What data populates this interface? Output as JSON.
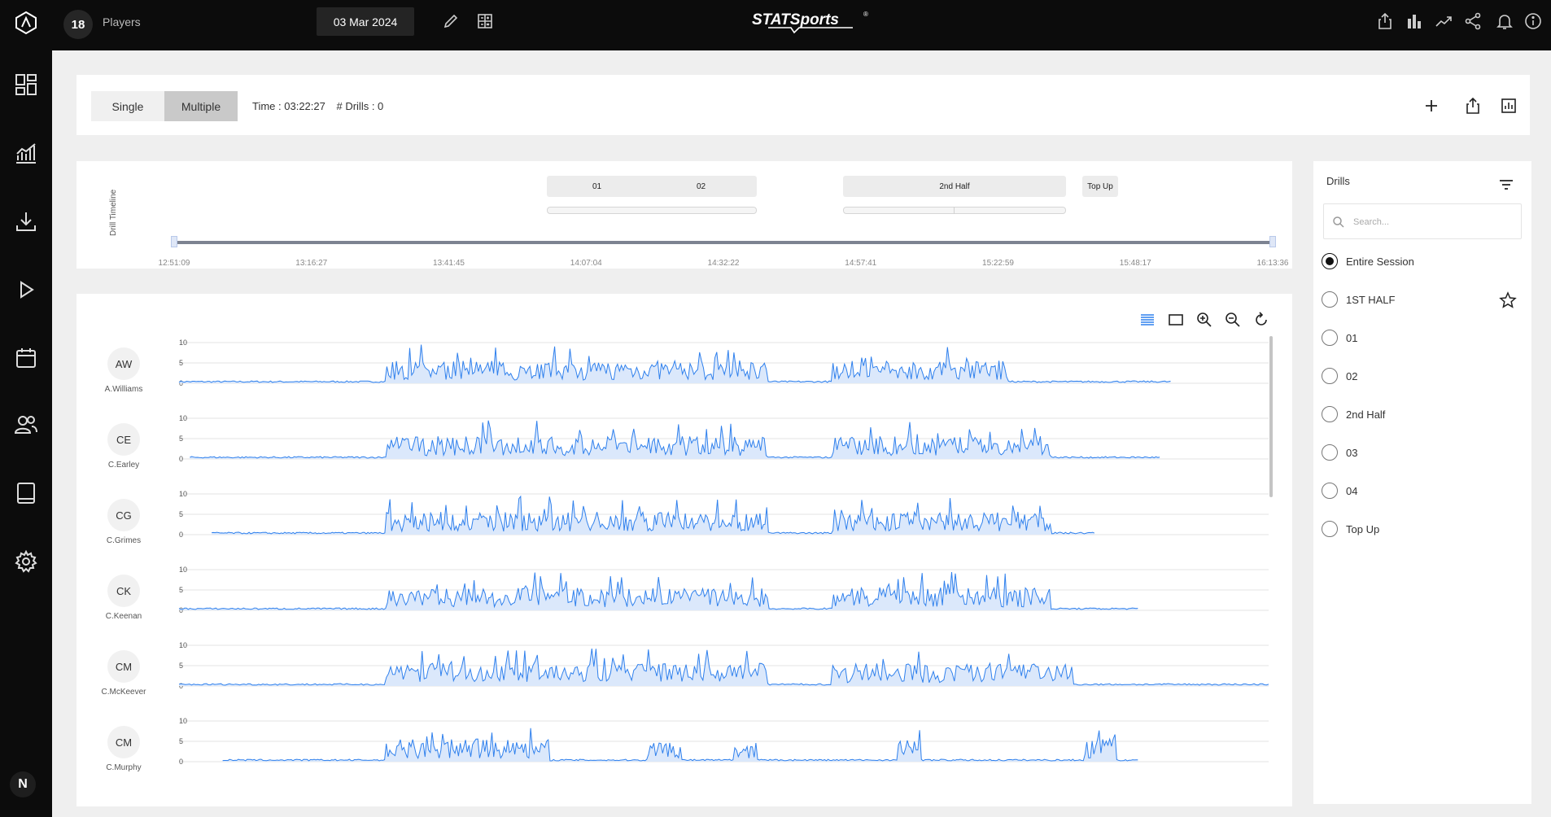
{
  "topbar": {
    "player_count": "18",
    "players_label": "Players",
    "date": "03 Mar 2024",
    "logo_text": "STATSports",
    "logo_mark": "®",
    "icons": [
      "edit-icon",
      "calculator-icon",
      "export-icon",
      "bar-chart-icon",
      "trend-icon",
      "share-icon",
      "bell-icon",
      "info-icon"
    ]
  },
  "sidebar": {
    "items": [
      "logo-icon",
      "dashboard-icon",
      "analysis-icon",
      "download-icon",
      "play-icon",
      "calendar-icon",
      "team-icon",
      "tablet-icon",
      "settings-icon"
    ],
    "user_initial": "N"
  },
  "toolbar": {
    "single_label": "Single",
    "multiple_label": "Multiple",
    "active_mode": "Multiple",
    "time_text": "Time : 03:22:27",
    "drills_text": "# Drills : 0"
  },
  "timeline": {
    "title": "Drill Timeline",
    "drills": [
      {
        "label": "01"
      },
      {
        "label": "02"
      },
      {
        "label": "2nd Half"
      },
      {
        "label": "Top Up"
      }
    ],
    "ticks": [
      "12:51:09",
      "13:16:27",
      "13:41:45",
      "14:07:04",
      "14:32:22",
      "14:57:41",
      "15:22:59",
      "15:48:17",
      "16:13:36"
    ]
  },
  "chart_data": {
    "type": "line",
    "ylim": [
      0,
      10
    ],
    "yticks": [
      "0",
      "5",
      "10"
    ],
    "color": "#2f80ed",
    "series": [
      {
        "initials": "AW",
        "name": "A.Williams"
      },
      {
        "initials": "CE",
        "name": "C.Earley"
      },
      {
        "initials": "CG",
        "name": "C.Grimes"
      },
      {
        "initials": "CK",
        "name": "C.Keenan"
      },
      {
        "initials": "CM",
        "name": "C.McKeever"
      },
      {
        "initials": "CM",
        "name": "C.Murphy"
      }
    ]
  },
  "drills_panel": {
    "title": "Drills",
    "search_placeholder": "Search...",
    "items": [
      {
        "label": "Entire Session",
        "selected": true
      },
      {
        "label": "1ST HALF",
        "selected": false
      },
      {
        "label": "01",
        "selected": false
      },
      {
        "label": "02",
        "selected": false
      },
      {
        "label": "2nd Half",
        "selected": false
      },
      {
        "label": "03",
        "selected": false
      },
      {
        "label": "04",
        "selected": false
      },
      {
        "label": "Top Up",
        "selected": false
      }
    ]
  }
}
